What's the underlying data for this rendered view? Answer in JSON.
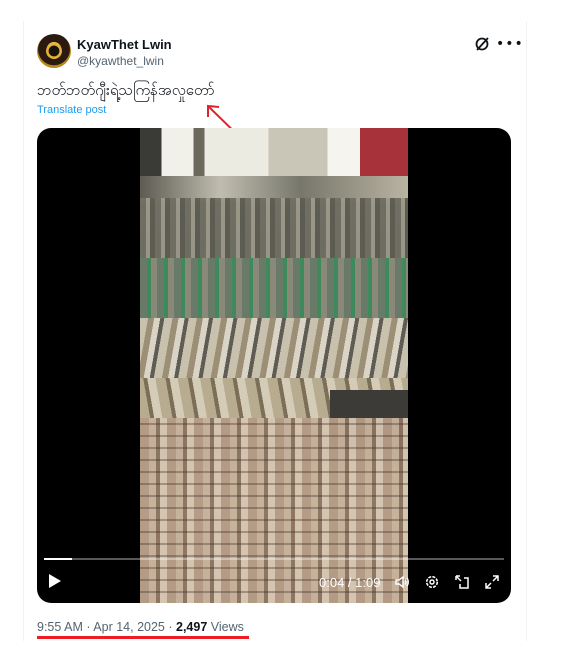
{
  "post": {
    "author_name": "KyawThet Lwin",
    "author_handle": "@kyawthet_lwin",
    "text": "ဘတ်ဘတ်ဂျီးရဲ့သကြန်အလှုတော်",
    "translate_label": "Translate post",
    "icons": {
      "grok": "grok-icon",
      "more": "more-icon"
    }
  },
  "video": {
    "current_time": "0:04",
    "duration": "1:09",
    "time_separator": " / ",
    "progress_fraction": 0.06,
    "controls": [
      "play-icon",
      "volume-icon",
      "settings-icon",
      "pip-icon",
      "fullscreen-icon"
    ]
  },
  "footer": {
    "time": "9:55 AM",
    "date": "Apr 14, 2025",
    "separator": " · ",
    "views_count": "2,497",
    "views_label": "Views"
  },
  "annotation": {
    "arrow_color": "#e0242b",
    "underline_color": "#ef1c24"
  }
}
